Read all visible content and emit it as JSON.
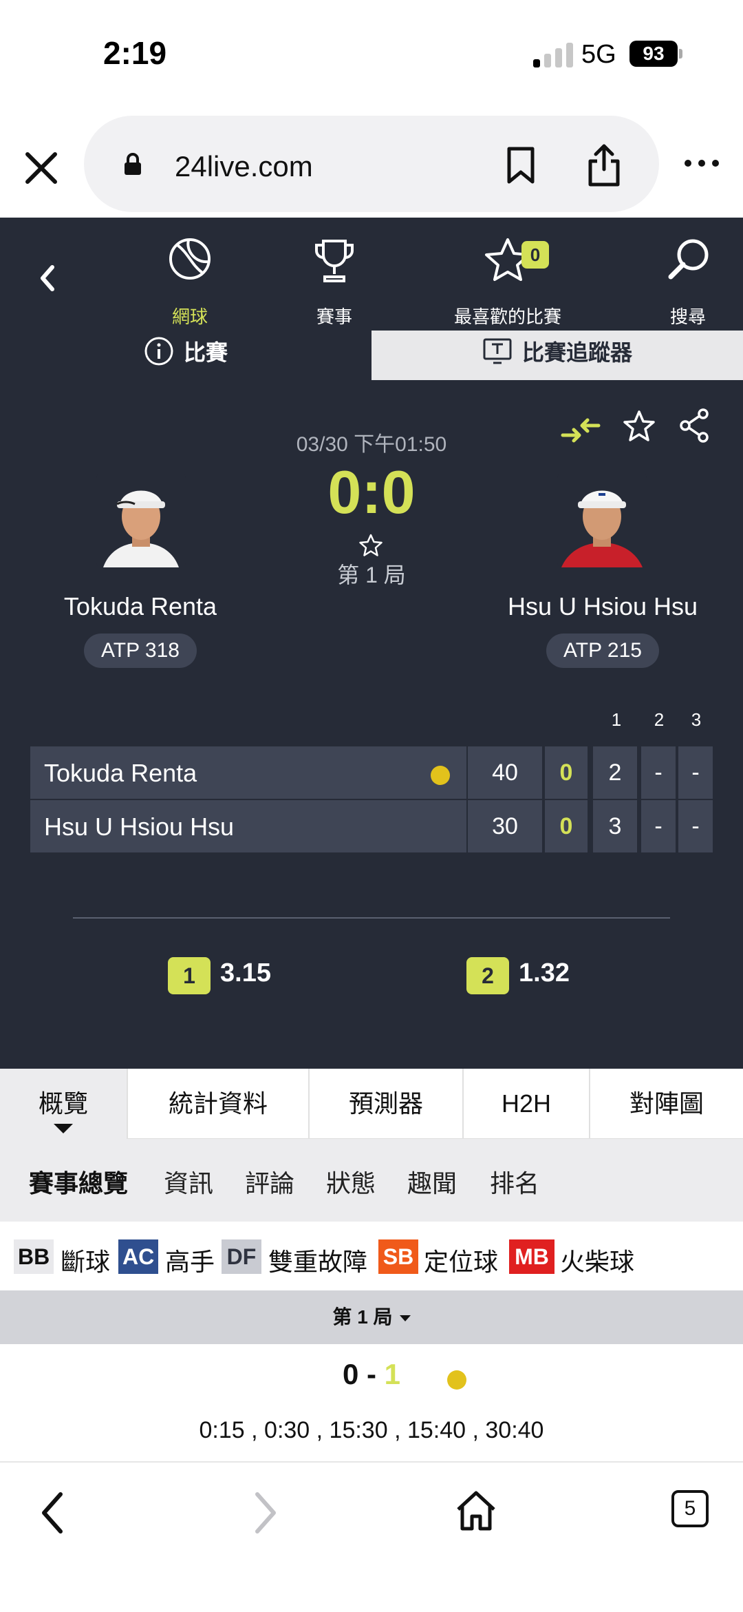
{
  "status_bar": {
    "time": "2:19",
    "network": "5G",
    "battery": "93"
  },
  "browser": {
    "url": "24live.com"
  },
  "nav": {
    "items": [
      {
        "label": "網球",
        "icon": "tennis-ball-icon",
        "active": true
      },
      {
        "label": "賽事",
        "icon": "trophy-icon",
        "active": false
      },
      {
        "label": "最喜歡的比賽",
        "icon": "star-icon",
        "active": false,
        "badge": "0"
      },
      {
        "label": "搜尋",
        "icon": "search-icon",
        "active": false
      }
    ]
  },
  "top_tabs": {
    "match": "比賽",
    "tracker": "比賽追蹤器"
  },
  "match": {
    "datetime": "03/30 下午01:50",
    "score": "0:0",
    "game_label": "第 1 局",
    "home": {
      "name": "Tokuda Renta",
      "rank": "ATP 318"
    },
    "away": {
      "name": "Hsu U Hsiou Hsu",
      "rank": "ATP 215"
    }
  },
  "scoreboard": {
    "set_headers": [
      "1",
      "2",
      "3"
    ],
    "rows": [
      {
        "name": "Tokuda Renta",
        "serving": true,
        "points": "40",
        "sets": "0",
        "s1": "2",
        "s2": "-",
        "s3": "-"
      },
      {
        "name": "Hsu U Hsiou Hsu",
        "serving": false,
        "points": "30",
        "sets": "0",
        "s1": "3",
        "s2": "-",
        "s3": "-"
      }
    ]
  },
  "odds": [
    {
      "badge": "1",
      "value": "3.15"
    },
    {
      "badge": "2",
      "value": "1.32"
    }
  ],
  "main_tabs": [
    "概覽",
    "統計資料",
    "預測器",
    "H2H",
    "對陣圖"
  ],
  "sub_tabs": [
    "賽事總覽",
    "資訊",
    "評論",
    "狀態",
    "趣聞",
    "排名"
  ],
  "legend": [
    {
      "code": "BB",
      "label": "斷球",
      "bg": "#e9e9ec",
      "fg": "#111111"
    },
    {
      "code": "AC",
      "label": "高手",
      "bg": "#2f4f8f",
      "fg": "#ffffff"
    },
    {
      "code": "DF",
      "label": "雙重故障",
      "bg": "#c9cbd2",
      "fg": "#2f3340"
    },
    {
      "code": "SB",
      "label": "定位球",
      "bg": "#f05a1a",
      "fg": "#ffffff"
    },
    {
      "code": "MB",
      "label": "火柴球",
      "bg": "#e02020",
      "fg": "#ffffff"
    }
  ],
  "game_section": {
    "title": "第 1 局",
    "score_left": "0",
    "score_sep": " - ",
    "score_right": "1",
    "points": "0:15 , 0:30 , 15:30 , 15:40 , 30:40"
  },
  "bottom_bar": {
    "tab_count": "5"
  },
  "colors": {
    "accent": "#d4e157",
    "panel": "#262b37",
    "cell": "#3f4555",
    "serve": "#e2c21c"
  }
}
